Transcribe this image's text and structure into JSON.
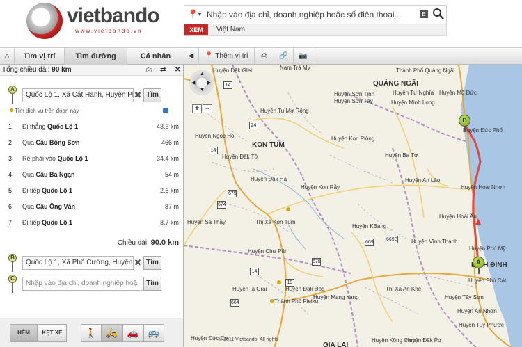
{
  "header": {
    "logo_text": "vietbando",
    "logo_url": "www.vietbando.vn",
    "search_placeholder": "Nhập vào địa chỉ, doanh nghiệp hoặc số điện thoại...",
    "keyboard_icon_label": "E",
    "view_button": "XEM",
    "region": "Việt Nam"
  },
  "tabs": {
    "find": "Tìm vị trí",
    "route": "Tìm đường",
    "personal": "Cá nhân"
  },
  "map_toolbar": {
    "add_location": "Thêm vị trí"
  },
  "route_panel": {
    "total_label": "Tổng chiều dài:",
    "total_value": "90 km",
    "point_a": {
      "marker": "A",
      "value": "Quốc Lộ 1, Xã Cát Hanh, Huyện Phù",
      "button": "Tìm"
    },
    "service_text": "Tìm dịch vụ trên đoạn này",
    "steps": [
      {
        "num": "1",
        "action": "Đi thẳng",
        "road": "Quốc Lộ 1",
        "dist": "43.6 km"
      },
      {
        "num": "2",
        "action": "Qua",
        "road": "Cầu Bồng Sơn",
        "dist": "466 m"
      },
      {
        "num": "3",
        "action": "Rẽ phải vào",
        "road": "Quốc Lộ 1",
        "dist": "34.4 km"
      },
      {
        "num": "4",
        "action": "Qua",
        "road": "Cầu Ba Ngạn",
        "dist": "54 m"
      },
      {
        "num": "5",
        "action": "Đi tiếp",
        "road": "Quốc Lộ 1",
        "dist": "2.6 km"
      },
      {
        "num": "6",
        "action": "Qua",
        "road": "Cầu Ông Văn",
        "dist": "87 m"
      },
      {
        "num": "7",
        "action": "Đi tiếp",
        "road": "Quốc Lộ 1",
        "dist": "8.7 km"
      }
    ],
    "length_label": "Chiều dài:",
    "length_value": "90.0 km",
    "point_b": {
      "marker": "B",
      "value": "Quốc Lộ 1, Xã Phổ Cường, Huyện Đ",
      "button": "Tìm"
    },
    "point_c": {
      "marker": "C",
      "placeholder": "Nhập vào địa chỉ, doanh nghiệp hoặ",
      "button": "Tìm"
    }
  },
  "bottom_bar": {
    "hem": "HẺM",
    "ket_xe": "KẸT XE"
  },
  "map": {
    "labels": [
      {
        "t": "Huyện Đăk Glei"
      },
      {
        "t": "Nam Trà My"
      },
      {
        "t": "Thành Phố Quảng Ngãi"
      },
      {
        "t": "QUẢNG NGÃI",
        "b": true
      },
      {
        "t": "Huyện Sơn Tịnh"
      },
      {
        "t": "Huyện Sơn Tây"
      },
      {
        "t": "Huyện Tư Nghĩa"
      },
      {
        "t": "Huyện Minh Long"
      },
      {
        "t": "Huyện Mộ Đức"
      },
      {
        "t": "Huyện Tu Mơ Rông"
      },
      {
        "t": "Huyện Ngọc Hồi"
      },
      {
        "t": "KON TUM",
        "b": true
      },
      {
        "t": "Huyện Kon Plông"
      },
      {
        "t": "Huyện Ba Tơ"
      },
      {
        "t": "Huyện Đăk Tô"
      },
      {
        "t": "Huyện Đăk Hà"
      },
      {
        "t": "Huyện Kon Rẫy"
      },
      {
        "t": "Huyện An Lão"
      },
      {
        "t": "Huyện Hoài Nhơn"
      },
      {
        "t": "Huyện Sa Thầy"
      },
      {
        "t": "Thị Xã Kon Tum"
      },
      {
        "t": "Huyện KBang"
      },
      {
        "t": "Huyện Hoài Ân"
      },
      {
        "t": "Huyện Vĩnh Thạnh"
      },
      {
        "t": "Huyện Phù Mỹ"
      },
      {
        "t": "Huyện Chư Păh"
      },
      {
        "t": "BÌNH ĐỊNH",
        "b": true
      },
      {
        "t": "Huyện Phù Cát"
      },
      {
        "t": "Huyện Ia Grai"
      },
      {
        "t": "Huyện Đak Đoa"
      },
      {
        "t": "Thị Xã An Khê"
      },
      {
        "t": "Huyện Tây Sơn"
      },
      {
        "t": "Thành Phố Pleiku"
      },
      {
        "t": "Huyện Mang Yang"
      },
      {
        "t": "Huyện An Nhơn"
      },
      {
        "t": "Huyện Tuy Phước"
      },
      {
        "t": "Huyện Kông Chro"
      },
      {
        "t": "Huyện Đức Cơ"
      },
      {
        "t": "Huyện Đăk Pơ"
      },
      {
        "t": "GIA LAI",
        "b": true
      },
      {
        "t": "Huyện Đức Phổ"
      }
    ],
    "road_shields": [
      "14",
      "24",
      "14",
      "675",
      "674",
      "669",
      "669B",
      "670",
      "14",
      "664",
      "19"
    ],
    "markers": [
      "A",
      "B"
    ],
    "copyright": "© 2011 Vietbando. All rights"
  }
}
